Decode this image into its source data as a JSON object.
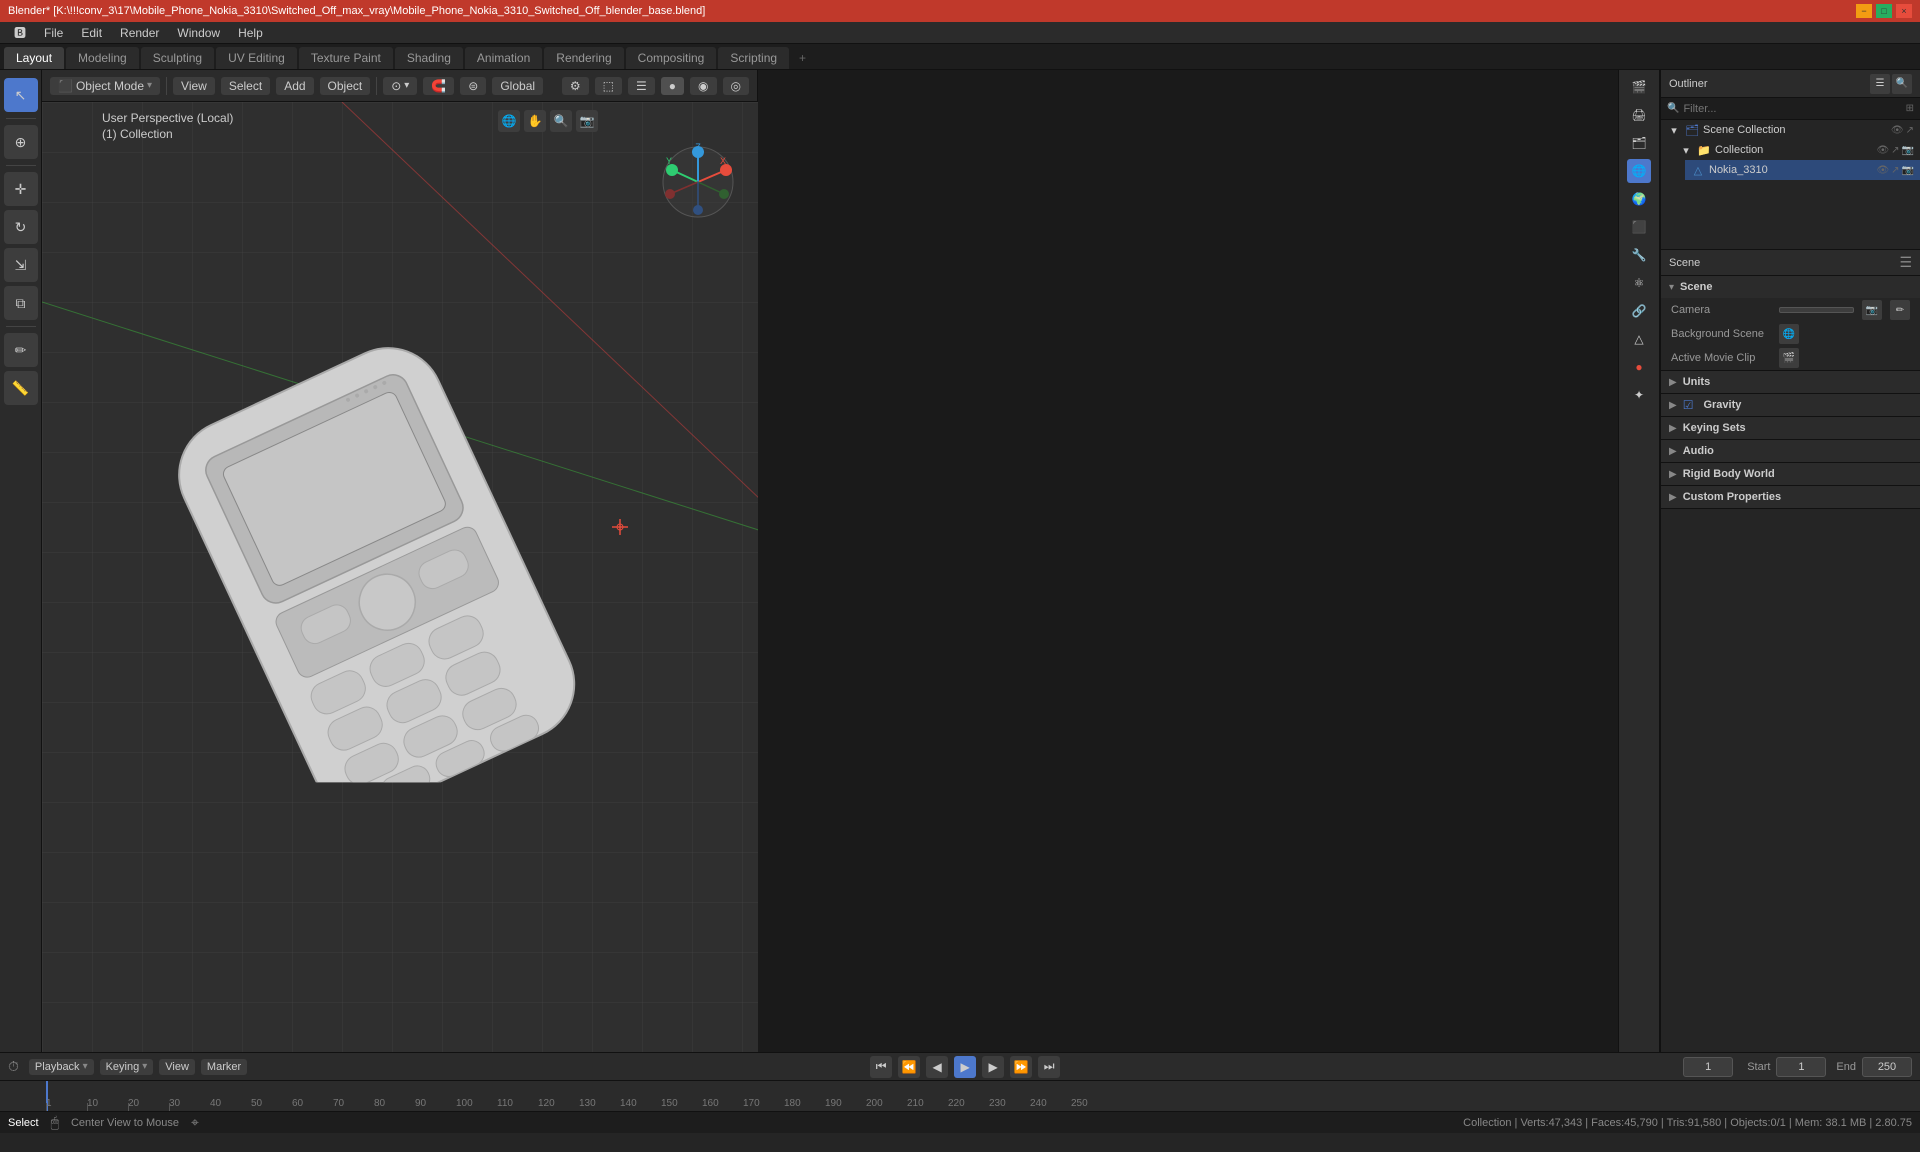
{
  "titlebar": {
    "title": "Blender* [K:\\!!!conv_3\\17\\Mobile_Phone_Nokia_3310\\Switched_Off_max_vray\\Mobile_Phone_Nokia_3310_Switched_Off_blender_base.blend]",
    "min_label": "−",
    "max_label": "□",
    "close_label": "×"
  },
  "menubar": {
    "items": [
      "Blender",
      "File",
      "Edit",
      "Render",
      "Window",
      "Help"
    ]
  },
  "workspace_tabs": {
    "tabs": [
      "Layout",
      "Modeling",
      "Sculpting",
      "UV Editing",
      "Texture Paint",
      "Shading",
      "Animation",
      "Rendering",
      "Compositing",
      "Scripting"
    ],
    "active": "Layout",
    "plus_label": "+"
  },
  "header": {
    "mode_label": "Object Mode",
    "view_label": "View",
    "select_label": "Select",
    "add_label": "Add",
    "object_label": "Object",
    "global_label": "Global"
  },
  "viewport": {
    "info_line1": "User Perspective (Local)",
    "info_line2": "(1) Collection"
  },
  "outliner": {
    "title": "Scene Collection",
    "items": [
      {
        "indent": 0,
        "icon": "🌐",
        "label": "Scene Collection"
      },
      {
        "indent": 1,
        "icon": "📁",
        "label": "Collection",
        "selected": false
      },
      {
        "indent": 2,
        "icon": "📱",
        "label": "Nokia_3310",
        "selected": true
      }
    ]
  },
  "properties": {
    "title": "Scene",
    "scene_label": "Scene",
    "tabs": [
      "render",
      "output",
      "viewlayer",
      "scene",
      "world",
      "object",
      "modifiers",
      "physics",
      "constraints",
      "objectdata",
      "material",
      "particles"
    ],
    "sections": [
      {
        "label": "Scene",
        "rows": [
          {
            "label": "Camera",
            "value": ""
          },
          {
            "label": "Background Scene",
            "value": ""
          },
          {
            "label": "Active Movie Clip",
            "value": ""
          }
        ]
      },
      {
        "label": "Units",
        "rows": []
      },
      {
        "label": "Gravity",
        "rows": [],
        "checkbox": true
      },
      {
        "label": "Keying Sets",
        "rows": []
      },
      {
        "label": "Audio",
        "rows": []
      },
      {
        "label": "Rigid Body World",
        "rows": []
      },
      {
        "label": "Custom Properties",
        "rows": []
      }
    ]
  },
  "timeline": {
    "playback_label": "Playback",
    "keying_label": "Keying",
    "view_label": "View",
    "marker_label": "Marker",
    "start_label": "Start",
    "end_label": "End",
    "start_value": "1",
    "end_value": "250",
    "current_frame": "1",
    "ticks": [
      "0",
      "10",
      "20",
      "30",
      "40",
      "50",
      "60",
      "70",
      "80",
      "90",
      "100",
      "110",
      "120",
      "130",
      "140",
      "150",
      "160",
      "170",
      "180",
      "190",
      "200",
      "210",
      "220",
      "230",
      "240",
      "250"
    ]
  },
  "statusbar": {
    "select_label": "Select",
    "center_label": "Center View to Mouse",
    "stats": "Collection | Verts:47,343 | Faces:45,790 | Tris:91,580 | Objects:0/1 | Mem: 38.1 MB | 2.80.75"
  }
}
